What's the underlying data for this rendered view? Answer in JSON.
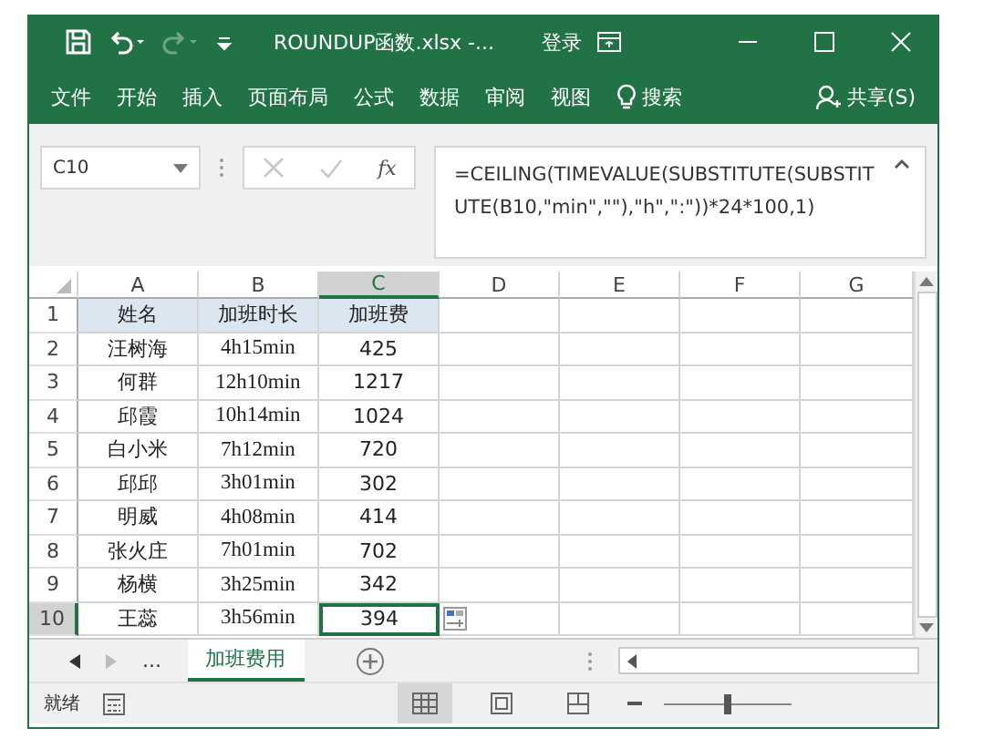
{
  "window": {
    "title": "ROUNDUP函数.xlsx -...",
    "login": "登录"
  },
  "menu": [
    {
      "label": "文件"
    },
    {
      "label": "开始"
    },
    {
      "label": "插入"
    },
    {
      "label": "页面布局"
    },
    {
      "label": "公式"
    },
    {
      "label": "数据"
    },
    {
      "label": "审阅"
    },
    {
      "label": "视图"
    },
    {
      "label": "搜索",
      "kind": "search"
    }
  ],
  "share": "共享(S)",
  "formula_bar": {
    "name_box": "C10",
    "fx": "fx",
    "formula": "=CEILING(TIMEVALUE(SUBSTITUTE(SUBSTITUTE(B10,\"min\",\"\"),\"h\",\":\"))*24*100,1)"
  },
  "columns": [
    {
      "label": "A",
      "selected": false
    },
    {
      "label": "B",
      "selected": false
    },
    {
      "label": "C",
      "selected": true
    },
    {
      "label": "D",
      "selected": false
    },
    {
      "label": "E",
      "selected": false
    },
    {
      "label": "F",
      "selected": false
    },
    {
      "label": "G",
      "selected": false
    }
  ],
  "rows": [
    {
      "number": "1",
      "header": true,
      "selected": false,
      "cells": [
        {
          "text": "姓名",
          "selected": false
        },
        {
          "text": "加班时长",
          "selected": false
        },
        {
          "text": "加班费",
          "selected": false
        }
      ]
    },
    {
      "number": "2",
      "header": false,
      "selected": false,
      "cells": [
        {
          "text": "汪树海",
          "selected": false
        },
        {
          "text": "4h15min",
          "selected": false
        },
        {
          "text": "425",
          "selected": false
        }
      ]
    },
    {
      "number": "3",
      "header": false,
      "selected": false,
      "cells": [
        {
          "text": "何群",
          "selected": false
        },
        {
          "text": "12h10min",
          "selected": false
        },
        {
          "text": "1217",
          "selected": false
        }
      ]
    },
    {
      "number": "4",
      "header": false,
      "selected": false,
      "cells": [
        {
          "text": "邱霞",
          "selected": false
        },
        {
          "text": "10h14min",
          "selected": false
        },
        {
          "text": "1024",
          "selected": false
        }
      ]
    },
    {
      "number": "5",
      "header": false,
      "selected": false,
      "cells": [
        {
          "text": "白小米",
          "selected": false
        },
        {
          "text": "7h12min",
          "selected": false
        },
        {
          "text": "720",
          "selected": false
        }
      ]
    },
    {
      "number": "6",
      "header": false,
      "selected": false,
      "cells": [
        {
          "text": "邱邱",
          "selected": false
        },
        {
          "text": "3h01min",
          "selected": false
        },
        {
          "text": "302",
          "selected": false
        }
      ]
    },
    {
      "number": "7",
      "header": false,
      "selected": false,
      "cells": [
        {
          "text": "明威",
          "selected": false
        },
        {
          "text": "4h08min",
          "selected": false
        },
        {
          "text": "414",
          "selected": false
        }
      ]
    },
    {
      "number": "8",
      "header": false,
      "selected": false,
      "cells": [
        {
          "text": "张火庄",
          "selected": false
        },
        {
          "text": "7h01min",
          "selected": false
        },
        {
          "text": "702",
          "selected": false
        }
      ]
    },
    {
      "number": "9",
      "header": false,
      "selected": false,
      "cells": [
        {
          "text": "杨横",
          "selected": false
        },
        {
          "text": "3h25min",
          "selected": false
        },
        {
          "text": "342",
          "selected": false
        }
      ]
    },
    {
      "number": "10",
      "header": false,
      "selected": true,
      "cells": [
        {
          "text": "王蕊",
          "selected": false
        },
        {
          "text": "3h56min",
          "selected": false
        },
        {
          "text": "394",
          "selected": true
        }
      ]
    }
  ],
  "sheet_tabs": {
    "more": "...",
    "tabs": [
      {
        "label": "加班费用",
        "selected": true
      }
    ]
  },
  "status_bar": {
    "status": "就绪",
    "views": [
      {
        "kind": "normal",
        "selected": true
      },
      {
        "kind": "page-layout",
        "selected": false
      },
      {
        "kind": "page-break",
        "selected": false
      }
    ],
    "zoom": {
      "level": 0.5
    }
  }
}
